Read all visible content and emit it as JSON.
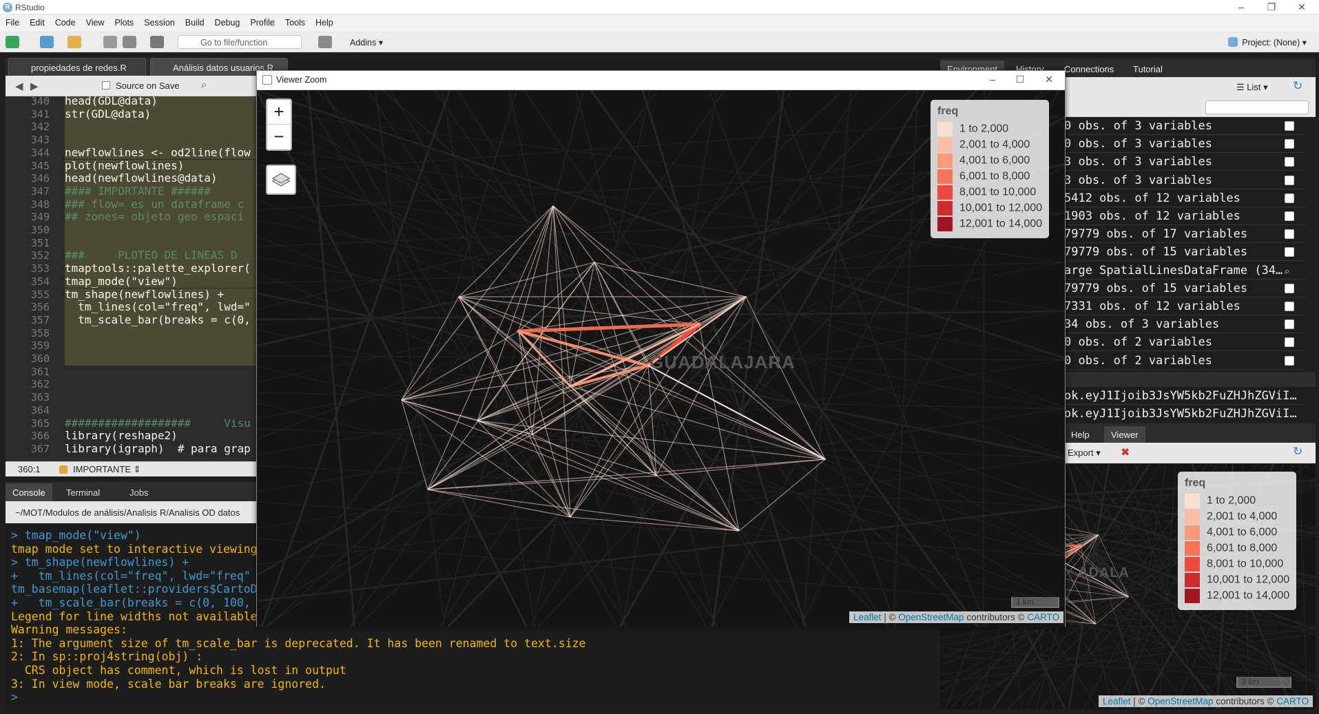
{
  "window": {
    "title": "RStudio"
  },
  "menu": [
    "File",
    "Edit",
    "Code",
    "View",
    "Plots",
    "Session",
    "Build",
    "Debug",
    "Profile",
    "Tools",
    "Help"
  ],
  "toolbar": {
    "goto_placeholder": "Go to file/function",
    "addins": "Addins",
    "project": "Project: (None)"
  },
  "editor": {
    "tabs": [
      "propiedades de redes.R",
      "Análisis datos usuarios.R"
    ],
    "source_on_save": "Source on Save",
    "lines": [
      {
        "n": "340",
        "code": "head(GDL@data)"
      },
      {
        "n": "341",
        "code": "str(GDL@data)"
      },
      {
        "n": "342",
        "code": ""
      },
      {
        "n": "343",
        "code": ""
      },
      {
        "n": "344",
        "code": "newflowlines <- od2line(flow"
      },
      {
        "n": "345",
        "code": "plot(newflowlines)"
      },
      {
        "n": "346",
        "code": "head(newflowlines@data)"
      },
      {
        "n": "347",
        "code": "#### IMPORTANTE ######"
      },
      {
        "n": "348",
        "code": "### flow= es un dataframe c"
      },
      {
        "n": "349",
        "code": "## zones= objeto geo espaci"
      },
      {
        "n": "350",
        "code": ""
      },
      {
        "n": "351",
        "code": ""
      },
      {
        "n": "352",
        "code": "###     PLOTEO DE LINEAS D"
      },
      {
        "n": "353",
        "code": "tmaptools::palette_explorer("
      },
      {
        "n": "354",
        "code": "tmap_mode(\"view\")"
      },
      {
        "n": "355",
        "code": "tm_shape(newflowlines) +"
      },
      {
        "n": "356",
        "code": "  tm_lines(col=\"freq\", lwd=\""
      },
      {
        "n": "357",
        "code": "  tm_scale_bar(breaks = c(0,"
      },
      {
        "n": "358",
        "code": ""
      },
      {
        "n": "359",
        "code": ""
      },
      {
        "n": "360",
        "code": ""
      },
      {
        "n": "361",
        "code": ""
      },
      {
        "n": "362",
        "code": ""
      },
      {
        "n": "363",
        "code": ""
      },
      {
        "n": "364",
        "code": ""
      },
      {
        "n": "365",
        "code": "###################     Visu"
      },
      {
        "n": "366",
        "code": "library(reshape2)"
      },
      {
        "n": "367",
        "code": "library(igraph)  # para grap"
      }
    ],
    "status_pos": "360:1",
    "status_section": "IMPORTANTE"
  },
  "console": {
    "tabs": [
      "Console",
      "Terminal",
      "Jobs"
    ],
    "path": "~/MOT/Modulos de análisis/Analisis R/Analisis OD datos",
    "lines": [
      {
        "t": "> tmap_mode(\"view\")",
        "c": "cmd"
      },
      {
        "t": "tmap mode set to interactive viewing",
        "c": "out"
      },
      {
        "t": "> tm_shape(newflowlines) +",
        "c": "cmd"
      },
      {
        "t": "+   tm_lines(col=\"freq\", lwd=\"freq\"",
        "c": "cmd"
      },
      {
        "t": "tm_basemap(leaflet::providers$CartoD",
        "c": "cmd"
      },
      {
        "t": "+   tm_scale_bar(breaks = c(0, 100,",
        "c": "cmd"
      },
      {
        "t": "Legend for line widths not available",
        "c": "out"
      },
      {
        "t": "Warning messages:",
        "c": "out"
      },
      {
        "t": "1: The argument size of tm_scale_bar is deprecated. It has been renamed to text.size",
        "c": "out"
      },
      {
        "t": "2: In sp::proj4string(obj) :",
        "c": "out"
      },
      {
        "t": "  CRS object has comment, which is lost in output",
        "c": "out"
      },
      {
        "t": "3: In view mode, scale bar breaks are ignored.",
        "c": "out"
      },
      {
        "t": "> ",
        "c": "cmd"
      }
    ]
  },
  "environment": {
    "tabs": [
      "Environment",
      "History",
      "Connections",
      "Tutorial"
    ],
    "list_label": "List",
    "rows": [
      "0 obs. of 3 variables",
      "0 obs. of 3 variables",
      "3 obs. of 3 variables",
      "3 obs. of 3 variables",
      "5412 obs. of 12 variables",
      "1903 obs. of 12 variables",
      "79779 obs. of 17 variables",
      "79779 obs. of 15 variables",
      "arge SpatialLinesDataFrame (34…",
      "79779 obs. of 15 variables",
      "7331 obs. of 12 variables",
      "34 obs. of 3 variables",
      "0 obs. of 2 variables",
      "0 obs. of 2 variables"
    ],
    "values": [
      "ok.eyJ1Ijoib3JsYW5kb2FuZHJhZGViI…",
      "ok.eyJ1Ijoib3JsYW5kb2FuZHJhZGViI…"
    ]
  },
  "viewer_pane": {
    "tabs": [
      "Help",
      "Viewer"
    ],
    "export": "Export",
    "scale": "3 km",
    "city": "ADALA"
  },
  "zoom_window": {
    "title": "Viewer Zoom",
    "city": "GUADALAJARA",
    "scale": "1 km"
  },
  "legend": {
    "title": "freq",
    "items": [
      {
        "label": "1 to 2,000",
        "color": "#fde0d2"
      },
      {
        "label": "2,001 to 4,000",
        "color": "#fcbba1"
      },
      {
        "label": "4,001 to 6,000",
        "color": "#fc9272"
      },
      {
        "label": "6,001 to 8,000",
        "color": "#fb6a4a"
      },
      {
        "label": "8,001 to 10,000",
        "color": "#ef3b2c"
      },
      {
        "label": "10,001 to 12,000",
        "color": "#cb181d"
      },
      {
        "label": "12,001 to 14,000",
        "color": "#99000d"
      }
    ]
  },
  "attribution": {
    "leaflet": "Leaflet",
    "sep": " | © ",
    "osm": "OpenStreetMap",
    "contrib": " contributors © ",
    "carto": "CARTO"
  },
  "colors": {
    "accent": "#75aadb",
    "console_cmd": "#3a9bd4",
    "console_out": "#f5b700",
    "flow_strong": "#ef4e37"
  }
}
